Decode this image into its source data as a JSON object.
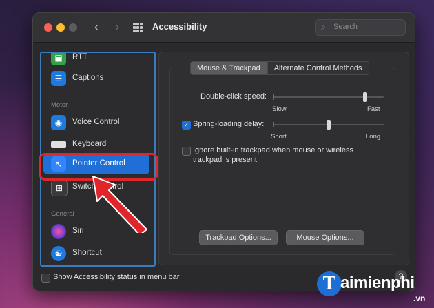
{
  "window": {
    "title": "Accessibility",
    "search_placeholder": "Search"
  },
  "toolbar": {
    "back_icon": "chevron-left-icon",
    "forward_icon": "chevron-right-icon",
    "grid_icon": "show-all-grid-icon"
  },
  "sidebar": {
    "items": [
      {
        "label": "RTT",
        "icon": "rtt-icon",
        "color": "#35a14a"
      },
      {
        "label": "Captions",
        "icon": "captions-icon",
        "color": "#1f7ae0"
      },
      {
        "label": "Voice Control",
        "icon": "voice-control-icon",
        "color": "#1f7ae0"
      },
      {
        "label": "Keyboard",
        "icon": "keyboard-icon",
        "color": "#d8d8d8"
      },
      {
        "label": "Pointer Control",
        "icon": "pointer-icon",
        "color": "#1f7ae0"
      },
      {
        "label": "Switch Control",
        "icon": "switch-control-icon",
        "color": "#3a3a3e"
      },
      {
        "label": "Siri",
        "icon": "siri-icon",
        "color": "#6b3fd0"
      },
      {
        "label": "Shortcut",
        "icon": "shortcut-icon",
        "color": "#1f7ae0"
      }
    ],
    "sections": {
      "motor": "Motor",
      "general": "General"
    },
    "selected": "Pointer Control"
  },
  "tabs": [
    {
      "label": "Mouse & Trackpad",
      "active": true
    },
    {
      "label": "Alternate Control Methods",
      "active": false
    }
  ],
  "settings": {
    "double_click": {
      "label": "Double-click speed:",
      "min_label": "Slow",
      "max_label": "Fast",
      "value_fraction": 0.83
    },
    "spring_loading": {
      "label": "Spring-loading delay:",
      "checked": true,
      "min_label": "Short",
      "max_label": "Long",
      "value_fraction": 0.5
    },
    "ignore_trackpad": {
      "label_line1": "Ignore built-in trackpad when mouse or wireless",
      "label_line2": "trackpad is present",
      "checked": false
    }
  },
  "buttons": {
    "trackpad_options": "Trackpad Options...",
    "mouse_options": "Mouse Options..."
  },
  "footer": {
    "show_status_label": "Show Accessibility status in menu bar",
    "show_status_checked": false,
    "help": "?"
  },
  "watermark": {
    "letter": "T",
    "text": "aimienphi",
    "suffix": ".vn"
  },
  "colors": {
    "accent": "#1f6fd6",
    "highlight": "#e0262b"
  }
}
